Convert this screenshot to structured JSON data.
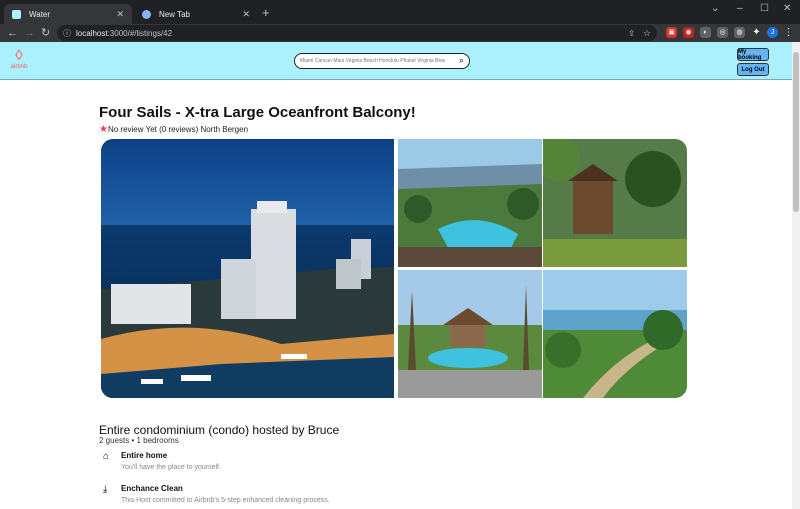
{
  "browser": {
    "tabs": [
      {
        "label": "Water",
        "active": true
      },
      {
        "label": "New Tab",
        "active": false
      }
    ],
    "url_host": "localhost",
    "url_path": ":3000/#/listings/42",
    "profile_initial": "J"
  },
  "header": {
    "logo_text": "airbnb",
    "search_placeholder": "Miami Cancun Maui Virginia Beach Honolulu Phuket Virginia Beach Fl",
    "my_booking_label": "My booking",
    "logout_label": "Log Out"
  },
  "listing": {
    "title": "Four Sails - X-tra Large Oceanfront Balcony!",
    "reviews_text": "No review Yet (0 reviews) North Bergen",
    "hosted_by": "Entire condominium (condo) hosted by Bruce",
    "guests_text": "2 guests • 1 bedrooms",
    "features": [
      {
        "icon": "home-icon",
        "title": "Entire home",
        "desc": "You'll have the place to yourself."
      },
      {
        "icon": "cleaning-icon",
        "title": "Enchance Clean",
        "desc": "This Host committed to Airbnb's 5-step enhanced cleaning process."
      }
    ]
  },
  "colors": {
    "header_bg": "#aaf0fd",
    "button_bg": "#64b5f6",
    "brand": "#ff5a5f"
  }
}
